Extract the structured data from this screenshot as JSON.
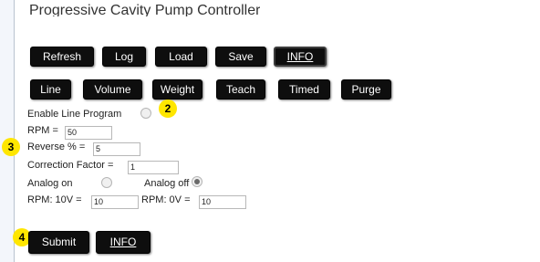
{
  "app": {
    "title": "Progressive Cavity Pump Controller"
  },
  "toolbar": {
    "refresh": "Refresh",
    "log": "Log",
    "load": "Load",
    "save": "Save",
    "info": "INFO"
  },
  "modes": {
    "line": "Line",
    "volume": "Volume",
    "weight": "Weight",
    "teach": "Teach",
    "timed": "Timed",
    "purge": "Purge"
  },
  "form": {
    "enable_line_program": {
      "label": "Enable Line Program",
      "checked": false
    },
    "rpm": {
      "label": "RPM =",
      "value": "50"
    },
    "reverse": {
      "label": "Reverse % =",
      "value": "5"
    },
    "correction_factor": {
      "label": "Correction Factor =",
      "value": "1"
    },
    "analog_on": {
      "label": "Analog on",
      "checked": false
    },
    "analog_off": {
      "label": "Analog off",
      "checked": true
    },
    "rpm_10v": {
      "label": "RPM: 10V =",
      "value": "10"
    },
    "rpm_0v": {
      "label": "RPM: 0V =",
      "value": "10"
    }
  },
  "footer": {
    "submit": "Submit",
    "info": "INFO"
  },
  "callouts": {
    "two": "2",
    "three": "3",
    "four": "4"
  },
  "colors": {
    "button_bg": "#0e0e0e",
    "badge": "#ffe600"
  }
}
